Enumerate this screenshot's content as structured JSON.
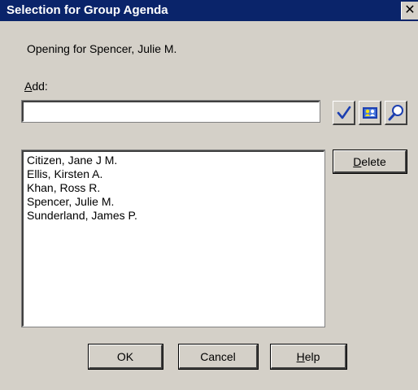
{
  "window": {
    "title": "Selection for Group Agenda",
    "close_glyph": "✕"
  },
  "opening": {
    "text": "Opening for Spencer, Julie M."
  },
  "add": {
    "label_mnemonic": "A",
    "label_rest": "dd:",
    "value": ""
  },
  "toolbar": {
    "icons": [
      "checkmark-icon",
      "address-book-icon",
      "search-icon"
    ]
  },
  "attendees": {
    "items": [
      "Citizen, Jane J M.",
      "Ellis, Kirsten A.",
      "Khan, Ross R.",
      "Spencer, Julie M.",
      "Sunderland, James P."
    ]
  },
  "buttons": {
    "delete_mnemonic": "D",
    "delete_rest": "elete",
    "ok": "OK",
    "cancel": "Cancel",
    "help_mnemonic": "H",
    "help_rest": "elp"
  },
  "colors": {
    "titlebar": "#0a246a",
    "face": "#d4d0c8",
    "accent_blue": "#1c3fb0"
  }
}
